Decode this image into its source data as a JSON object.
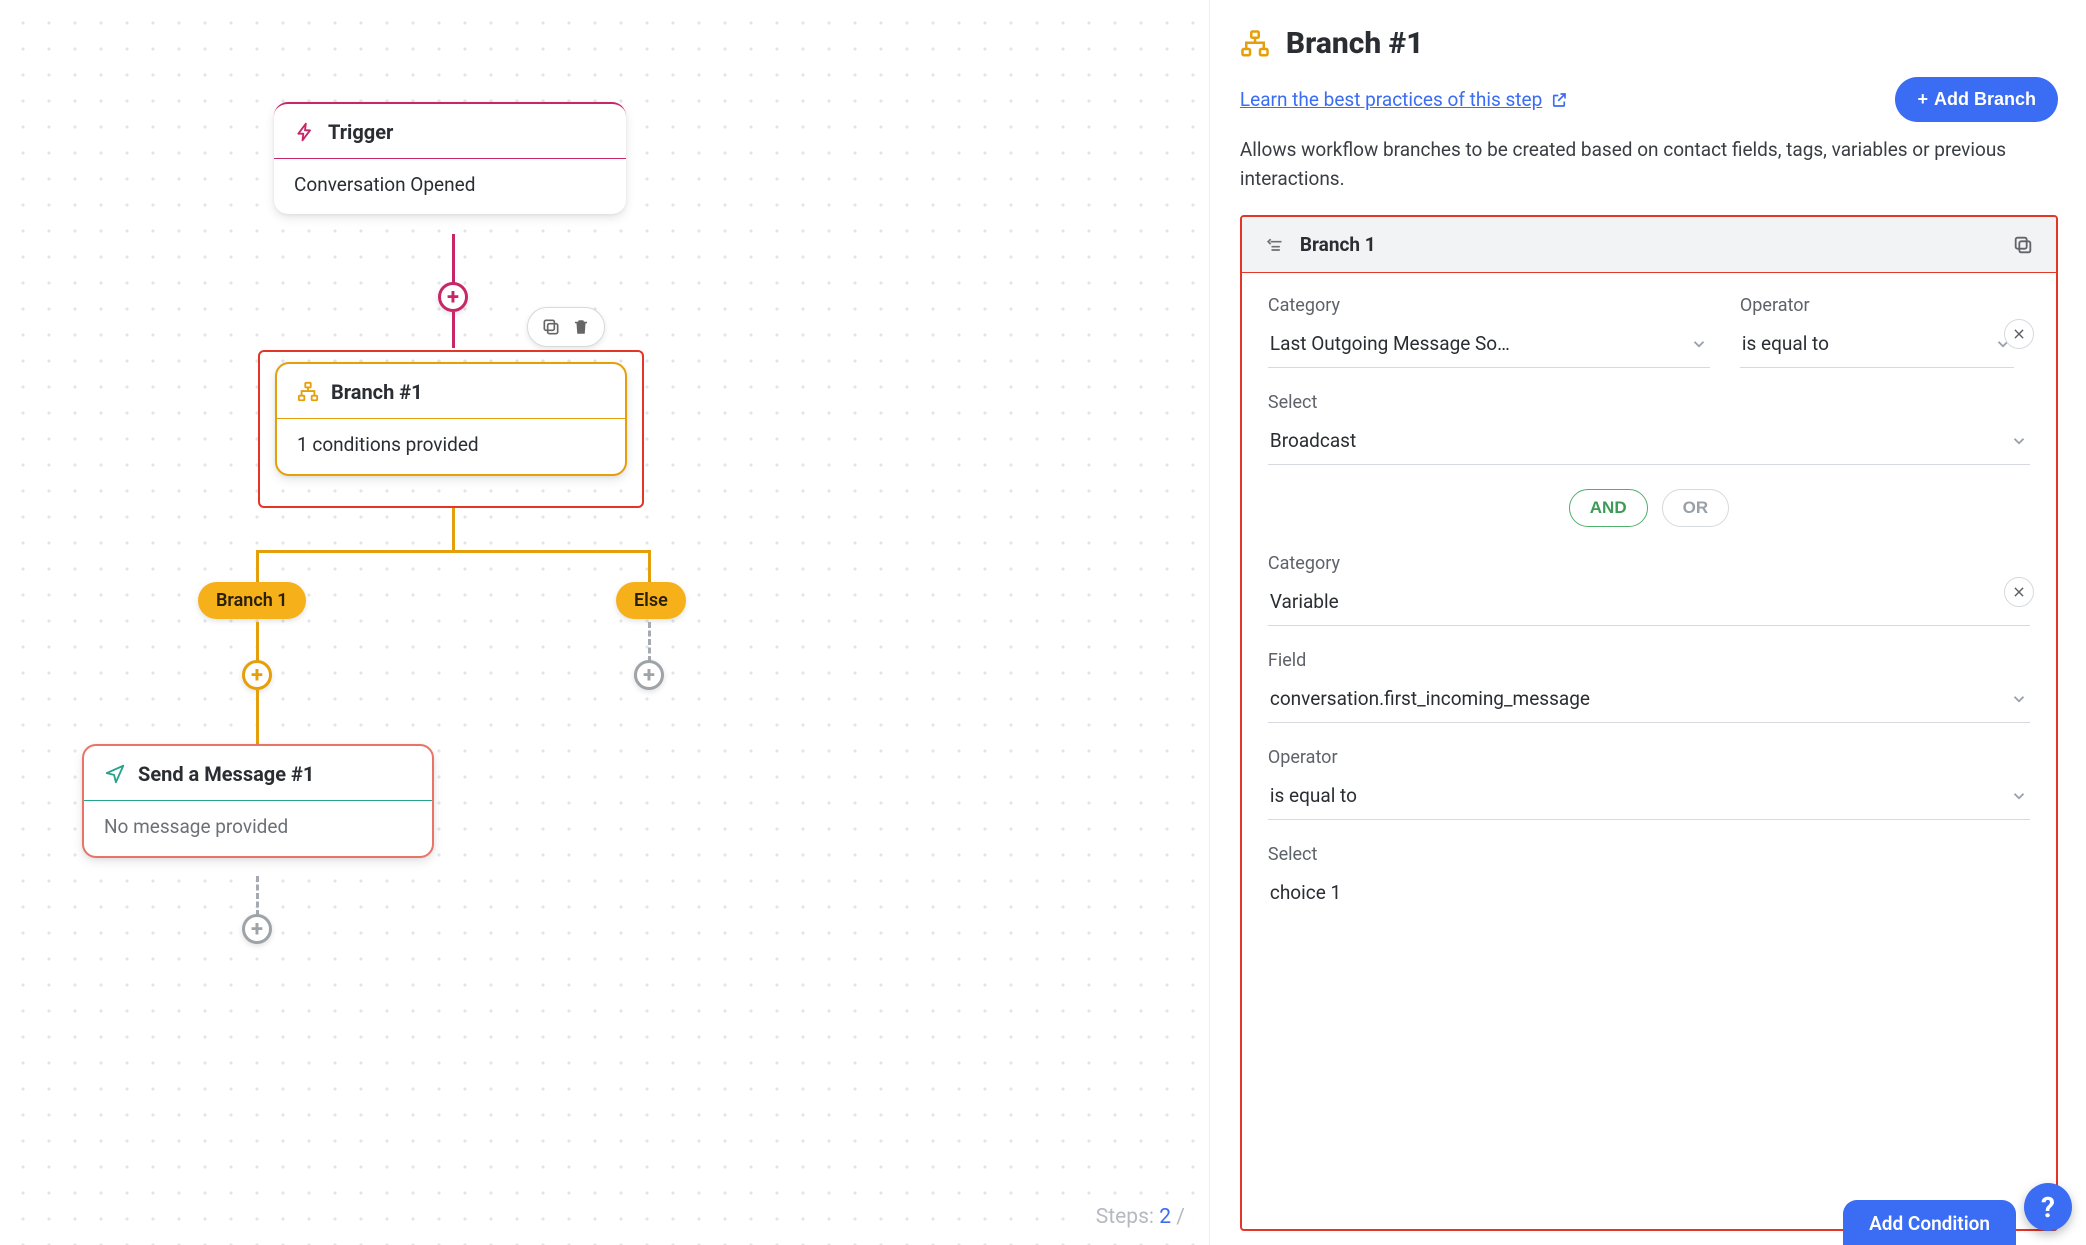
{
  "canvas": {
    "steps_label_prefix": "Steps: ",
    "steps_current": "2",
    "steps_suffix": " /",
    "trigger": {
      "title": "Trigger",
      "body": "Conversation Opened"
    },
    "branch": {
      "title": "Branch #1",
      "body": "1 conditions provided"
    },
    "labels": {
      "branch1": "Branch 1",
      "else": "Else"
    },
    "message": {
      "title": "Send a Message #1",
      "body": "No message provided"
    }
  },
  "side": {
    "title": "Branch #1",
    "learn_text": "Learn the best practices of this step",
    "add_branch": "Add Branch",
    "description": "Allows workflow branches to be created based on contact fields, tags, variables or previous interactions.",
    "branch_header": "Branch 1",
    "add_condition": "Add Condition",
    "logic": {
      "and": "AND",
      "or": "OR"
    },
    "labels": {
      "category": "Category",
      "operator": "Operator",
      "select": "Select",
      "field": "Field"
    },
    "conditions": [
      {
        "category": "Last Outgoing Message So…",
        "operator": "is equal to",
        "select": "Broadcast"
      },
      {
        "category": "Variable",
        "field": "conversation.first_incoming_message",
        "operator": "is equal to",
        "select": "choice 1"
      }
    ]
  }
}
